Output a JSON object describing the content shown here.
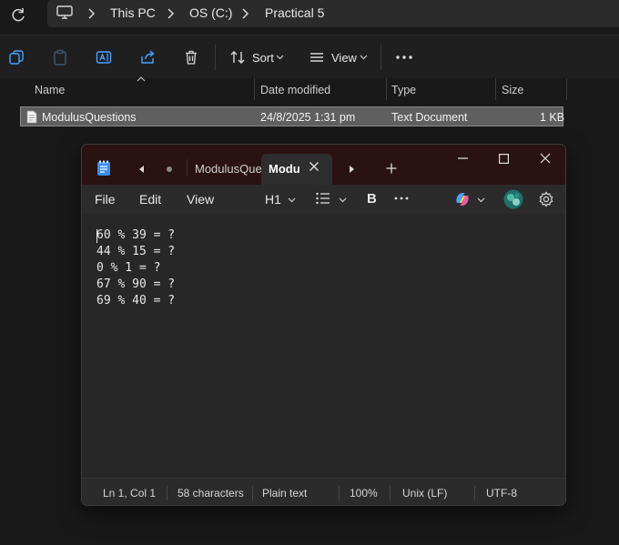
{
  "explorer": {
    "breadcrumb": [
      "This PC",
      "OS (C:)",
      "Practical 5"
    ],
    "toolbar": {
      "sort_label": "Sort",
      "view_label": "View"
    },
    "columns": [
      "Name",
      "Date modified",
      "Type",
      "Size"
    ],
    "files": [
      {
        "name": "ModulusQuestions",
        "date": "24/8/2025 1:31 pm",
        "type": "Text Document",
        "size": "1 KB"
      }
    ]
  },
  "notepad": {
    "tabs": [
      {
        "label": "ModulusQue",
        "active": false
      },
      {
        "label": "Modu",
        "active": true
      }
    ],
    "menu": [
      "File",
      "Edit",
      "View"
    ],
    "heading_label": "H1",
    "bold_label": "B",
    "lines": [
      "60 % 39 = ?",
      "44 % 15 = ?",
      "0 % 1 = ?",
      "67 % 90 = ?",
      "69 % 40 = ?"
    ],
    "status": {
      "position": "Ln 1, Col 1",
      "chars": "58 characters",
      "format": "Plain text",
      "zoom": "100%",
      "line_ending": "Unix (LF)",
      "encoding": "UTF-8"
    },
    "colors": {
      "titlebar": "#2a1212",
      "editor": "#272727",
      "accent": "#4aa3ff"
    }
  }
}
